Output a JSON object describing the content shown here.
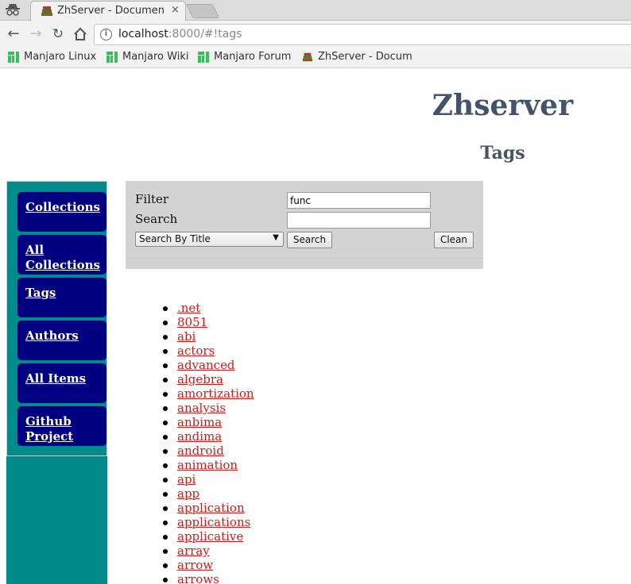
{
  "browser": {
    "tab_title": "ZhServer - Documen",
    "tab_close": "×",
    "url_host": "localhost",
    "url_rest": ":8000/#!tags",
    "bookmarks": [
      "Manjaro Linux",
      "Manjaro Wiki",
      "Manjaro Forum",
      "ZhServer - Docum"
    ]
  },
  "page": {
    "site_title": "Zhserver",
    "heading": "Tags"
  },
  "sidebar": {
    "items": [
      {
        "label": "Collections"
      },
      {
        "label": "All Collections"
      },
      {
        "label": "Tags"
      },
      {
        "label": "Authors"
      },
      {
        "label": "All Items"
      },
      {
        "label": "Github Project"
      }
    ]
  },
  "filter": {
    "filter_label": "Filter",
    "filter_value": "func",
    "search_label": "Search",
    "search_value": "",
    "select_value": "Search By Title",
    "search_button": "Search",
    "clean_button": "Clean"
  },
  "tags": [
    ".net",
    "8051",
    "abi",
    "actors",
    "advanced",
    "algebra",
    "amortization",
    "analysis",
    "anbima",
    "andima",
    "android",
    "animation",
    "api",
    "app",
    "application",
    "applications",
    "applicative",
    "array",
    "arrow",
    "arrows"
  ],
  "colors": {
    "sidebar_bg": "#008b8b",
    "nav_item_bg": "#000080",
    "title_color": "#43536a",
    "link_color": "#d01a1a",
    "panel_bg": "#d3d3d3"
  }
}
